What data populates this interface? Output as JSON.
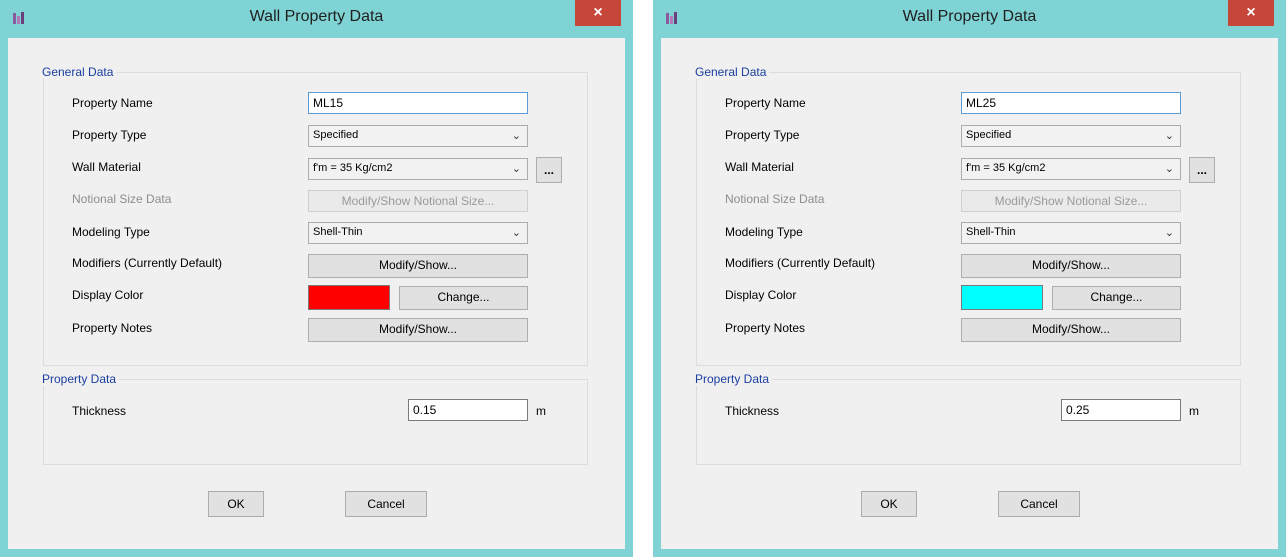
{
  "dialogs": [
    {
      "title": "Wall Property Data",
      "close_label": "×",
      "general_group_label": "General Data",
      "property_name_label": "Property Name",
      "property_name_value": "ML15",
      "property_type_label": "Property Type",
      "property_type_value": "Specified",
      "wall_material_label": "Wall Material",
      "wall_material_value": "f'm = 35 Kg/cm2",
      "ellipsis_label": "...",
      "notional_label": "Notional Size Data",
      "notional_button": "Modify/Show Notional Size...",
      "modeling_type_label": "Modeling Type",
      "modeling_type_value": "Shell-Thin",
      "modifiers_label": "Modifiers (Currently Default)",
      "modifiers_button": "Modify/Show...",
      "display_color_label": "Display Color",
      "display_color": "#ff0000",
      "change_button": "Change...",
      "notes_label": "Property Notes",
      "notes_button": "Modify/Show...",
      "property_group_label": "Property Data",
      "thickness_label": "Thickness",
      "thickness_value": "0.15",
      "thickness_unit": "m",
      "ok_label": "OK",
      "cancel_label": "Cancel"
    },
    {
      "title": "Wall Property Data",
      "close_label": "×",
      "general_group_label": "General Data",
      "property_name_label": "Property Name",
      "property_name_value": "ML25",
      "property_type_label": "Property Type",
      "property_type_value": "Specified",
      "wall_material_label": "Wall Material",
      "wall_material_value": "f'm = 35 Kg/cm2",
      "ellipsis_label": "...",
      "notional_label": "Notional Size Data",
      "notional_button": "Modify/Show Notional Size...",
      "modeling_type_label": "Modeling Type",
      "modeling_type_value": "Shell-Thin",
      "modifiers_label": "Modifiers (Currently Default)",
      "modifiers_button": "Modify/Show...",
      "display_color_label": "Display Color",
      "display_color": "#00ffff",
      "change_button": "Change...",
      "notes_label": "Property Notes",
      "notes_button": "Modify/Show...",
      "property_group_label": "Property Data",
      "thickness_label": "Thickness",
      "thickness_value": "0.25",
      "thickness_unit": "m",
      "ok_label": "OK",
      "cancel_label": "Cancel"
    }
  ]
}
